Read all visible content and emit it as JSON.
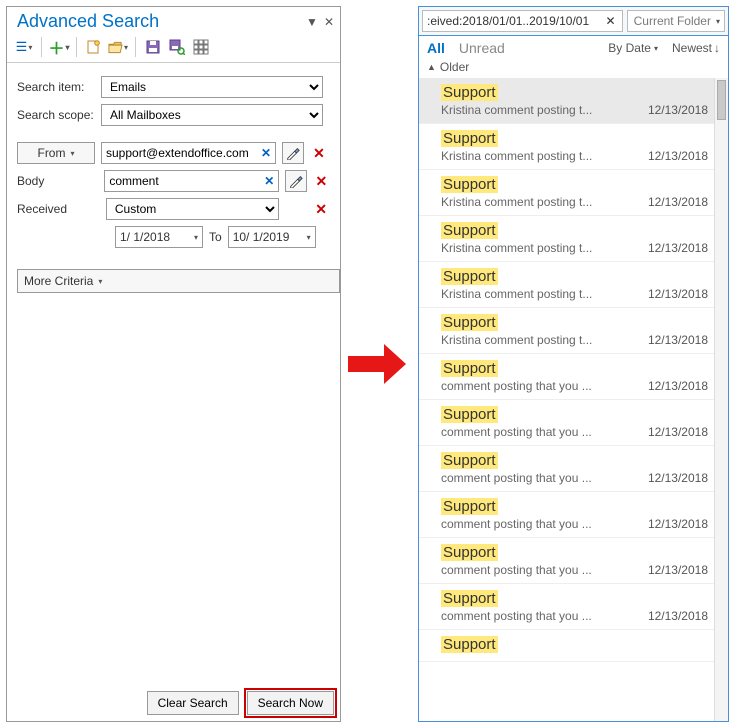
{
  "left": {
    "title": "Advanced Search",
    "search_item_label": "Search item:",
    "search_item_value": "Emails",
    "search_scope_label": "Search scope:",
    "search_scope_value": "All Mailboxes",
    "from_btn": "From",
    "from_value": "support@extendoffice.com",
    "body_label": "Body",
    "body_value": "comment",
    "received_label": "Received",
    "received_value": "Custom",
    "date_from": "1/ 1/2018",
    "date_to_label": "To",
    "date_to": "10/ 1/2019",
    "more_criteria": "More Criteria",
    "clear_btn": "Clear Search",
    "search_btn": "Search Now"
  },
  "right": {
    "search_text": ":eived:2018/01/01..2019/10/01",
    "scope": "Current Folder",
    "tab_all": "All",
    "tab_unread": "Unread",
    "sort_by": "By Date",
    "sort_order": "Newest",
    "group": "Older",
    "items": [
      {
        "sender": "Support",
        "subject": "Kristina comment posting t...",
        "date": "12/13/2018",
        "selected": true
      },
      {
        "sender": "Support",
        "subject": "Kristina comment posting t...",
        "date": "12/13/2018"
      },
      {
        "sender": "Support",
        "subject": "Kristina comment posting t...",
        "date": "12/13/2018"
      },
      {
        "sender": "Support",
        "subject": "Kristina comment posting t...",
        "date": "12/13/2018"
      },
      {
        "sender": "Support",
        "subject": "Kristina comment posting t...",
        "date": "12/13/2018"
      },
      {
        "sender": "Support",
        "subject": "Kristina comment posting t...",
        "date": "12/13/2018"
      },
      {
        "sender": "Support",
        "subject": "comment posting that you ...",
        "date": "12/13/2018"
      },
      {
        "sender": "Support",
        "subject": "comment posting that you ...",
        "date": "12/13/2018"
      },
      {
        "sender": "Support",
        "subject": "comment posting that you ...",
        "date": "12/13/2018"
      },
      {
        "sender": "Support",
        "subject": "comment posting that you ...",
        "date": "12/13/2018"
      },
      {
        "sender": "Support",
        "subject": "comment posting that you ...",
        "date": "12/13/2018"
      },
      {
        "sender": "Support",
        "subject": "comment posting that you ...",
        "date": "12/13/2018"
      },
      {
        "sender": "Support",
        "subject": "",
        "date": ""
      }
    ]
  }
}
